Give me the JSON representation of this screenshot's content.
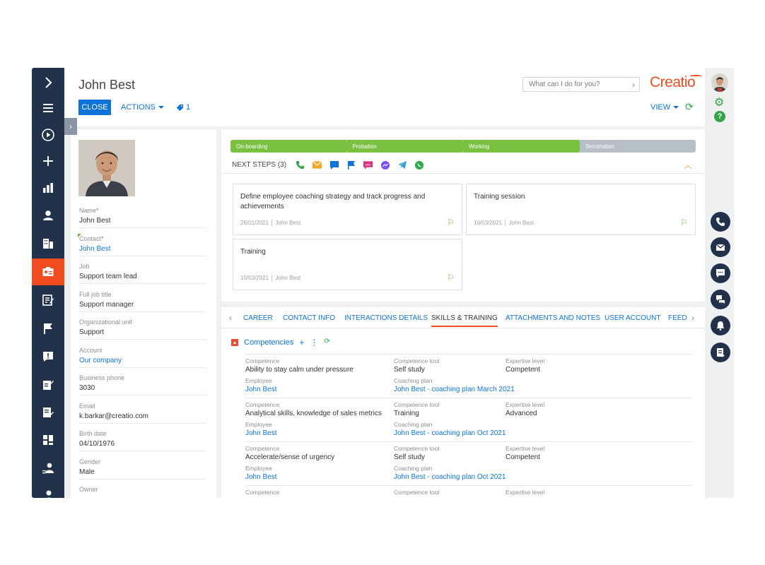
{
  "header": {
    "title": "John Best",
    "close_label": "CLOSE",
    "actions_label": "ACTIONS",
    "tag_count": "1",
    "search_placeholder": "What can I do for you?",
    "logo_text": "Creatio",
    "view_label": "VIEW"
  },
  "profile": {
    "fields": [
      {
        "label": "Name",
        "required": true,
        "value": "John Best",
        "link": false
      },
      {
        "label": "Contact",
        "required": true,
        "value": "John Best",
        "link": true
      },
      {
        "label": "Job",
        "required": false,
        "value": "Support team lead",
        "link": false
      },
      {
        "label": "Full job title",
        "required": false,
        "value": "Support manager",
        "link": false
      },
      {
        "label": "Organizational unit",
        "required": false,
        "value": "Support",
        "link": false
      },
      {
        "label": "Account",
        "required": false,
        "value": "Our company",
        "link": true
      },
      {
        "label": "Business phone",
        "required": false,
        "value": "3030",
        "link": false
      },
      {
        "label": "Email",
        "required": false,
        "value": "k.barkar@creatio.com",
        "link": false
      },
      {
        "label": "Birth date",
        "required": false,
        "value": "04/10/1976",
        "link": false
      },
      {
        "label": "Gender",
        "required": false,
        "value": "Male",
        "link": false
      },
      {
        "label": "Owner",
        "required": false,
        "value": "",
        "link": false
      }
    ]
  },
  "stages": [
    "On-boarding",
    "Probation",
    "Working",
    "Termination"
  ],
  "stages_completed": 3,
  "next_steps": {
    "label": "NEXT STEPS (3)",
    "icons": [
      "phone-icon",
      "email-icon",
      "chat-icon",
      "flag-icon",
      "sms-icon",
      "messenger-icon",
      "telegram-icon",
      "whatsapp-icon"
    ],
    "cards": [
      {
        "title": "Define employee coaching strategy and track progress and achievements",
        "date": "26/01/2021",
        "owner": "John Best"
      },
      {
        "title": "Training session",
        "date": "10/03/2021",
        "owner": "John Best"
      },
      {
        "title": "Training",
        "date": "10/03/2021",
        "owner": "John Best"
      }
    ]
  },
  "tabs": [
    "CAREER",
    "CONTACT INFO",
    "INTERACTIONS DETAILS",
    "SKILLS & TRAINING",
    "ATTACHMENTS AND NOTES",
    "USER ACCOUNT",
    "FEED"
  ],
  "active_tab": "SKILLS & TRAINING",
  "competencies": {
    "title": "Competencies",
    "labels": {
      "competence": "Competence",
      "tool": "Competence tool",
      "level": "Expertise level",
      "employee": "Employee",
      "plan": "Coaching plan"
    },
    "rows": [
      {
        "competence": "Ability to stay calm under pressure",
        "tool": "Self study",
        "level": "Competent",
        "employee": "John Best",
        "plan": "John Best - coaching plan March 2021"
      },
      {
        "competence": "Analytical skills, knowledge of sales metrics",
        "tool": "Training",
        "level": "Advanced",
        "employee": "John Best",
        "plan": "John Best - coaching plan Oct 2021"
      },
      {
        "competence": "Accelerate/sense of urgency",
        "tool": "Self study",
        "level": "Competent",
        "employee": "John Best",
        "plan": "John Best - coaching plan Oct 2021"
      },
      {
        "competence": "",
        "tool": "",
        "level": "",
        "employee": "",
        "plan": ""
      }
    ]
  },
  "colors": {
    "nav_bg": "#22324a",
    "accent": "#f04c1f",
    "link": "#0d73d8",
    "stage_done": "#7ac142",
    "stage_todo": "#b8bec5"
  }
}
